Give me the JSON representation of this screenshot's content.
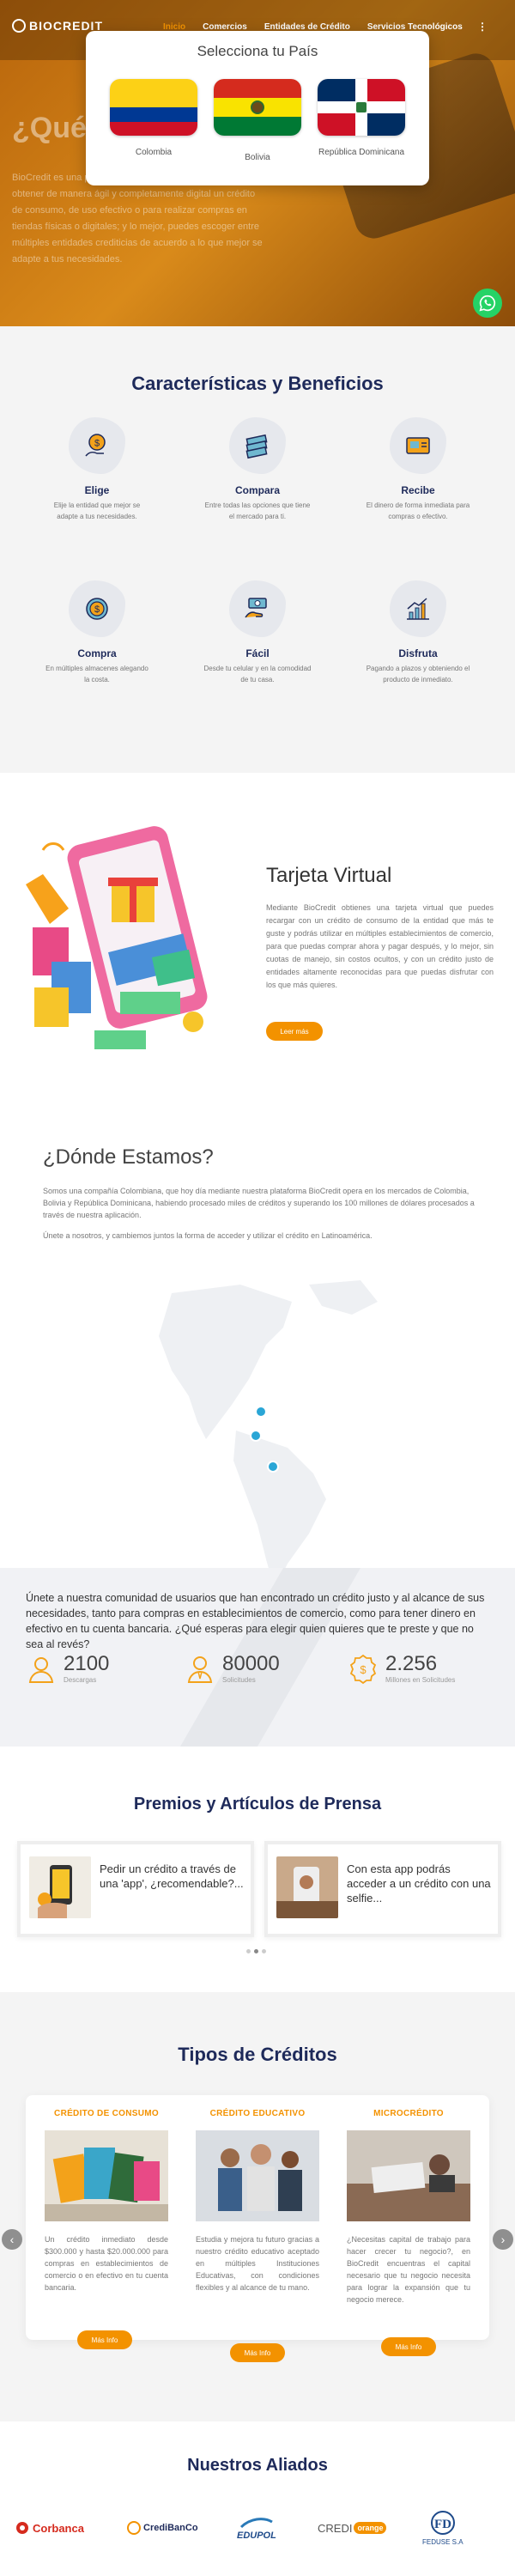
{
  "header": {
    "logo": "BIOCREDIT",
    "nav": [
      "Inicio",
      "Comercios",
      "Entidades de Crédito",
      "Servicios Tecnológicos"
    ],
    "more": "⋮"
  },
  "hero": {
    "title": "¿Qué",
    "text": "BioCredit es una plataforma que facilita a las personas obtener de manera ágil y completamente digital un crédito de consumo, de uso efectivo o para realizar compras en tiendas físicas o digitales; y lo mejor, puedes escoger entre múltiples entidades crediticias de acuerdo a lo que mejor se adapte a tus necesidades."
  },
  "modal": {
    "title": "Selecciona tu País",
    "countries": [
      "Colombia",
      "Bolivia",
      "República Dominicana"
    ]
  },
  "features": {
    "title": "Características y Beneficios",
    "items": [
      {
        "title": "Elige",
        "desc": "Elije la entidad que mejor se adapte a tus necesidades.",
        "icon": "choose-money-icon"
      },
      {
        "title": "Compara",
        "desc": "Entre todas las opciones que tiene el mercado para ti.",
        "icon": "compare-money-icon"
      },
      {
        "title": "Recibe",
        "desc": "El dinero de forma inmediata para compras o efectivo.",
        "icon": "receive-card-icon"
      },
      {
        "title": "Compra",
        "desc": "En múltiples almacenes alegando la costa.",
        "icon": "buy-coin-icon"
      },
      {
        "title": "Fácil",
        "desc": "Desde tu celular y en la comodidad de tu casa.",
        "icon": "easy-hand-icon"
      },
      {
        "title": "Disfruta",
        "desc": "Pagando a plazos y obteniendo el producto de inmediato.",
        "icon": "growth-chart-icon"
      }
    ]
  },
  "tarjeta": {
    "title": "Tarjeta Virtual",
    "text": "Mediante BioCredit obtienes una tarjeta virtual que puedes recargar con un crédito de consumo de la entidad que más te guste y podrás utilizar en múltiples establecimientos de comercio, para que puedas comprar ahora y pagar después, y lo mejor, sin cuotas de manejo, sin costos ocultos, y con un crédito justo de entidades altamente reconocidas para que puedas disfrutar con los que más quieres.",
    "button": "Leer más"
  },
  "donde": {
    "title": "¿Dónde Estamos?",
    "p1": "Somos una compañía Colombiana, que hoy día mediante nuestra plataforma BioCredit opera en los mercados de Colombia, Bolivia y República Dominicana, habiendo procesado miles de créditos y superando los 100 millones de dólares procesados a través de nuestra aplicación.",
    "p2": "Únete a nosotros, y cambiemos juntos la forma de acceder y utilizar el crédito en Latinoamérica."
  },
  "stats": {
    "text": "Únete a nuestra comunidad de usuarios que han encontrado un crédito justo y al alcance de sus necesidades, tanto para compras en establecimientos de comercio, como para tener dinero en efectivo en tu cuenta bancaria. ¿Qué esperas para elegir quien quieres que te preste y que no sea al revés?",
    "items": [
      {
        "value": "2100",
        "label": "Descargas"
      },
      {
        "value": "80000",
        "label": "Solicitudes"
      },
      {
        "value": "2.256",
        "label": "Millones en Solicitudes"
      }
    ]
  },
  "premios": {
    "title": "Premios y Artículos de Prensa",
    "cards": [
      "Pedir un crédito a través de una 'app', ¿recomendable?...",
      "Con esta app podrás acceder a un crédito con una selfie..."
    ]
  },
  "tipos": {
    "title": "Tipos de Créditos",
    "items": [
      {
        "title": "CRÉDITO DE CONSUMO",
        "desc": "Un crédito inmediato desde $300.000 y hasta $20.000.000 para compras en establecimientos de comercio o en efectivo en tu cuenta bancaria.",
        "button": "Más Info"
      },
      {
        "title": "CRÉDITO EDUCATIVO",
        "desc": "Estudia y mejora tu futuro gracias a nuestro crédito educativo aceptado en múltiples Instituciones Educativas, con condiciones flexibles y al alcance de tu mano.",
        "button": "Más Info"
      },
      {
        "title": "MICROCRÉDITO",
        "desc": "¿Necesitas capital de trabajo para hacer crecer tu negocio?, en BioCredit encuentras el capital necesario que tu negocio necesita para lograr la expansión que tu negocio merece.",
        "button": "Más Info"
      }
    ]
  },
  "aliados": {
    "title": "Nuestros Aliados",
    "logos": [
      "Corbanca",
      "CrediBanCo",
      "EDUPOL",
      "CREDI",
      "orange",
      "FEDUSE S.A"
    ]
  },
  "colors": {
    "accent": "#f39200",
    "navy": "#1e2a5a",
    "whatsapp": "#25d366"
  }
}
